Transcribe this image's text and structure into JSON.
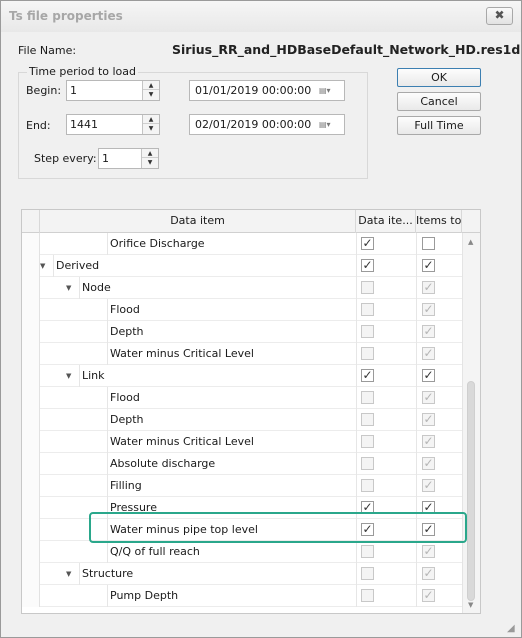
{
  "window": {
    "title": "Ts file properties",
    "close_glyph": "✖"
  },
  "file": {
    "label": "File Name:",
    "value": "Sirius_RR_and_HDBaseDefault_Network_HD.res1d"
  },
  "time_period": {
    "group_title": "Time period  to load",
    "begin_label": "Begin:",
    "begin_value": "1",
    "begin_date": "01/01/2019 00:00:00",
    "end_label": "End:",
    "end_value": "1441",
    "end_date": "02/01/2019 00:00:00",
    "step_label": "Step every:",
    "step_value": "1"
  },
  "buttons": {
    "ok": "OK",
    "cancel": "Cancel",
    "full_time": "Full Time"
  },
  "grid": {
    "columns": [
      "Data item",
      "Data ite...",
      "Items to..."
    ],
    "rows": [
      {
        "label": "Orifice Discharge",
        "level": 3,
        "expander": "",
        "data_item": true,
        "data_enabled": true,
        "items_to": false,
        "items_enabled": true
      },
      {
        "label": "Derived",
        "level": 1,
        "expander": "down",
        "data_item": true,
        "data_enabled": true,
        "items_to": true,
        "items_enabled": true
      },
      {
        "label": "Node",
        "level": 2,
        "expander": "down",
        "data_item": false,
        "data_enabled": false,
        "items_to": true,
        "items_enabled": false
      },
      {
        "label": "Flood",
        "level": 3,
        "expander": "",
        "data_item": false,
        "data_enabled": false,
        "items_to": true,
        "items_enabled": false
      },
      {
        "label": "Depth",
        "level": 3,
        "expander": "",
        "data_item": false,
        "data_enabled": false,
        "items_to": true,
        "items_enabled": false
      },
      {
        "label": "Water minus Critical Level",
        "level": 3,
        "expander": "",
        "data_item": false,
        "data_enabled": false,
        "items_to": true,
        "items_enabled": false
      },
      {
        "label": "Link",
        "level": 2,
        "expander": "down",
        "data_item": true,
        "data_enabled": true,
        "items_to": true,
        "items_enabled": true
      },
      {
        "label": "Flood",
        "level": 3,
        "expander": "",
        "data_item": false,
        "data_enabled": false,
        "items_to": true,
        "items_enabled": false
      },
      {
        "label": "Depth",
        "level": 3,
        "expander": "",
        "data_item": false,
        "data_enabled": false,
        "items_to": true,
        "items_enabled": false
      },
      {
        "label": "Water minus Critical Level",
        "level": 3,
        "expander": "",
        "data_item": false,
        "data_enabled": false,
        "items_to": true,
        "items_enabled": false
      },
      {
        "label": "Absolute discharge",
        "level": 3,
        "expander": "",
        "data_item": false,
        "data_enabled": false,
        "items_to": true,
        "items_enabled": false
      },
      {
        "label": "Filling",
        "level": 3,
        "expander": "",
        "data_item": false,
        "data_enabled": false,
        "items_to": true,
        "items_enabled": false
      },
      {
        "label": "Pressure",
        "level": 3,
        "expander": "",
        "data_item": true,
        "data_enabled": true,
        "items_to": true,
        "items_enabled": true
      },
      {
        "label": "Water minus pipe top level",
        "level": 3,
        "expander": "",
        "data_item": true,
        "data_enabled": true,
        "items_to": true,
        "items_enabled": true
      },
      {
        "label": "Q/Q of full reach",
        "level": 3,
        "expander": "",
        "data_item": false,
        "data_enabled": false,
        "items_to": true,
        "items_enabled": false
      },
      {
        "label": "Structure",
        "level": 2,
        "expander": "down",
        "data_item": false,
        "data_enabled": false,
        "items_to": true,
        "items_enabled": false
      },
      {
        "label": "Pump Depth",
        "level": 3,
        "expander": "",
        "data_item": false,
        "data_enabled": false,
        "items_to": true,
        "items_enabled": false
      }
    ]
  },
  "highlight": {
    "row_label": "Water minus pipe top level",
    "color": "#2aa78b"
  },
  "icons": {
    "spin_up": "▲",
    "spin_down": "▼",
    "calendar": "▤▾",
    "expander": "▼",
    "check": "✓",
    "scroll_up": "▲",
    "scroll_down": "▼",
    "grip": "◢"
  }
}
